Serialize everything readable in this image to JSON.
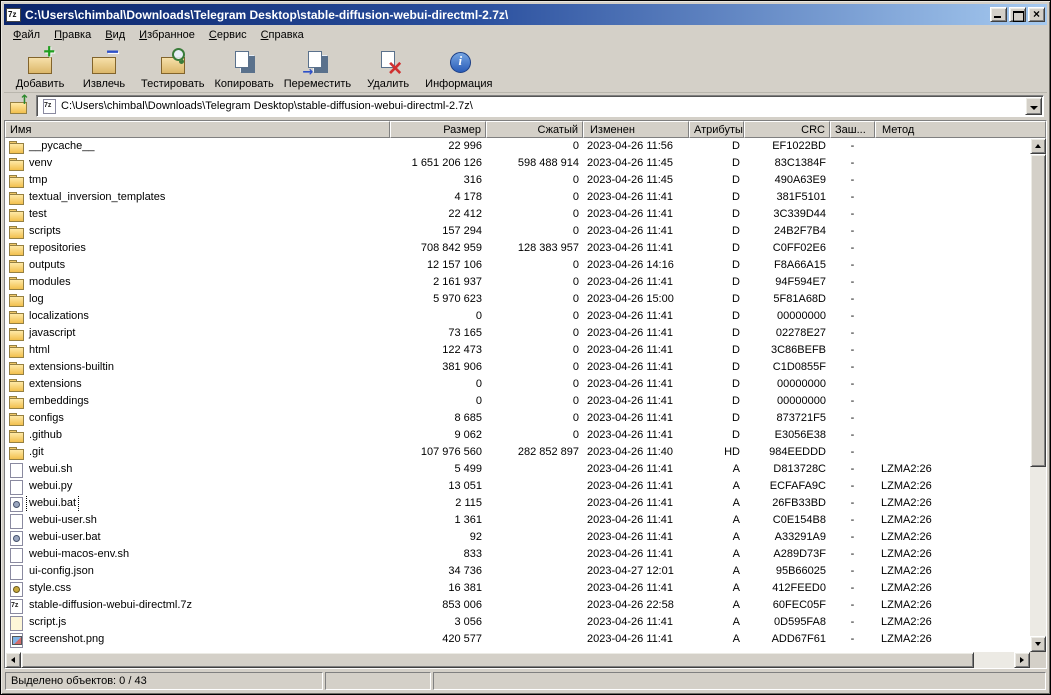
{
  "window": {
    "title": "C:\\Users\\chimbal\\Downloads\\Telegram Desktop\\stable-diffusion-webui-directml-2.7z\\",
    "app_icon": "7zip-app-icon",
    "control_icons": [
      "minimize-icon",
      "maximize-icon",
      "close-icon"
    ]
  },
  "colors": {
    "chrome": "#d4d0c8",
    "titlebar_start": "#0a246a",
    "titlebar_end": "#a6caf0",
    "list_background": "#ffffff"
  },
  "menu": {
    "items": [
      {
        "label": "Файл",
        "key": "file"
      },
      {
        "label": "Правка",
        "key": "edit"
      },
      {
        "label": "Вид",
        "key": "view"
      },
      {
        "label": "Избранное",
        "key": "favorites"
      },
      {
        "label": "Сервис",
        "key": "tools"
      },
      {
        "label": "Справка",
        "key": "help"
      }
    ]
  },
  "toolbar": {
    "buttons": [
      {
        "label": "Добавить",
        "icon": "add"
      },
      {
        "label": "Извлечь",
        "icon": "extract"
      },
      {
        "label": "Тестировать",
        "icon": "test"
      },
      {
        "label": "Копировать",
        "icon": "copy"
      },
      {
        "label": "Переместить",
        "icon": "move"
      },
      {
        "label": "Удалить",
        "icon": "delete"
      },
      {
        "label": "Информация",
        "icon": "info"
      }
    ]
  },
  "address": {
    "path": "C:\\Users\\chimbal\\Downloads\\Telegram Desktop\\stable-diffusion-webui-directml-2.7z\\",
    "icons": [
      "up-folder-icon",
      "archive-icon",
      "chevron-down-icon"
    ]
  },
  "list": {
    "columns": [
      {
        "label": "Имя",
        "key": "name"
      },
      {
        "label": "Размер",
        "key": "size"
      },
      {
        "label": "Сжатый",
        "key": "compressed"
      },
      {
        "label": "Изменен",
        "key": "modified"
      },
      {
        "label": "Атрибуты",
        "key": "attributes"
      },
      {
        "label": "CRC",
        "key": "crc"
      },
      {
        "label": "Заш...",
        "key": "encrypted"
      },
      {
        "label": "Метод",
        "key": "method"
      }
    ],
    "rows": [
      {
        "icon": "folder",
        "name": "__pycache__",
        "size": "22 996",
        "compressed": "0",
        "modified": "2023-04-26 11:56",
        "attributes": "D",
        "crc": "EF1022BD",
        "encrypted": "-",
        "method": ""
      },
      {
        "icon": "folder",
        "name": "venv",
        "size": "1 651 206 126",
        "compressed": "598 488 914",
        "modified": "2023-04-26 11:45",
        "attributes": "D",
        "crc": "83C1384F",
        "encrypted": "-",
        "method": ""
      },
      {
        "icon": "folder",
        "name": "tmp",
        "size": "316",
        "compressed": "0",
        "modified": "2023-04-26 11:45",
        "attributes": "D",
        "crc": "490A63E9",
        "encrypted": "-",
        "method": ""
      },
      {
        "icon": "folder",
        "name": "textual_inversion_templates",
        "size": "4 178",
        "compressed": "0",
        "modified": "2023-04-26 11:41",
        "attributes": "D",
        "crc": "381F5101",
        "encrypted": "-",
        "method": ""
      },
      {
        "icon": "folder",
        "name": "test",
        "size": "22 412",
        "compressed": "0",
        "modified": "2023-04-26 11:41",
        "attributes": "D",
        "crc": "3C339D44",
        "encrypted": "-",
        "method": ""
      },
      {
        "icon": "folder",
        "name": "scripts",
        "size": "157 294",
        "compressed": "0",
        "modified": "2023-04-26 11:41",
        "attributes": "D",
        "crc": "24B2F7B4",
        "encrypted": "-",
        "method": ""
      },
      {
        "icon": "folder",
        "name": "repositories",
        "size": "708 842 959",
        "compressed": "128 383 957",
        "modified": "2023-04-26 11:41",
        "attributes": "D",
        "crc": "C0FF02E6",
        "encrypted": "-",
        "method": ""
      },
      {
        "icon": "folder",
        "name": "outputs",
        "size": "12 157 106",
        "compressed": "0",
        "modified": "2023-04-26 14:16",
        "attributes": "D",
        "crc": "F8A66A15",
        "encrypted": "-",
        "method": ""
      },
      {
        "icon": "folder",
        "name": "modules",
        "size": "2 161 937",
        "compressed": "0",
        "modified": "2023-04-26 11:41",
        "attributes": "D",
        "crc": "94F594E7",
        "encrypted": "-",
        "method": ""
      },
      {
        "icon": "folder",
        "name": "log",
        "size": "5 970 623",
        "compressed": "0",
        "modified": "2023-04-26 15:00",
        "attributes": "D",
        "crc": "5F81A68D",
        "encrypted": "-",
        "method": ""
      },
      {
        "icon": "folder",
        "name": "localizations",
        "size": "0",
        "compressed": "0",
        "modified": "2023-04-26 11:41",
        "attributes": "D",
        "crc": "00000000",
        "encrypted": "-",
        "method": ""
      },
      {
        "icon": "folder",
        "name": "javascript",
        "size": "73 165",
        "compressed": "0",
        "modified": "2023-04-26 11:41",
        "attributes": "D",
        "crc": "02278E27",
        "encrypted": "-",
        "method": ""
      },
      {
        "icon": "folder",
        "name": "html",
        "size": "122 473",
        "compressed": "0",
        "modified": "2023-04-26 11:41",
        "attributes": "D",
        "crc": "3C86BEFB",
        "encrypted": "-",
        "method": ""
      },
      {
        "icon": "folder",
        "name": "extensions-builtin",
        "size": "381 906",
        "compressed": "0",
        "modified": "2023-04-26 11:41",
        "attributes": "D",
        "crc": "C1D0855F",
        "encrypted": "-",
        "method": ""
      },
      {
        "icon": "folder",
        "name": "extensions",
        "size": "0",
        "compressed": "0",
        "modified": "2023-04-26 11:41",
        "attributes": "D",
        "crc": "00000000",
        "encrypted": "-",
        "method": ""
      },
      {
        "icon": "folder",
        "name": "embeddings",
        "size": "0",
        "compressed": "0",
        "modified": "2023-04-26 11:41",
        "attributes": "D",
        "crc": "00000000",
        "encrypted": "-",
        "method": ""
      },
      {
        "icon": "folder",
        "name": "configs",
        "size": "8 685",
        "compressed": "0",
        "modified": "2023-04-26 11:41",
        "attributes": "D",
        "crc": "873721F5",
        "encrypted": "-",
        "method": ""
      },
      {
        "icon": "folder",
        "name": ".github",
        "size": "9 062",
        "compressed": "0",
        "modified": "2023-04-26 11:41",
        "attributes": "D",
        "crc": "E3056E38",
        "encrypted": "-",
        "method": ""
      },
      {
        "icon": "folder",
        "name": ".git",
        "size": "107 976 560",
        "compressed": "282 852 897",
        "modified": "2023-04-26 11:40",
        "attributes": "HD",
        "crc": "984EEDDD",
        "encrypted": "-",
        "method": ""
      },
      {
        "icon": "file",
        "name": "webui.sh",
        "size": "5 499",
        "compressed": "",
        "modified": "2023-04-26 11:41",
        "attributes": "A",
        "crc": "D813728C",
        "encrypted": "-",
        "method": "LZMA2:26"
      },
      {
        "icon": "file",
        "name": "webui.py",
        "size": "13 051",
        "compressed": "",
        "modified": "2023-04-26 11:41",
        "attributes": "A",
        "crc": "ECFAFA9C",
        "encrypted": "-",
        "method": "LZMA2:26"
      },
      {
        "icon": "bat",
        "name": "webui.bat",
        "size": "2 115",
        "compressed": "",
        "modified": "2023-04-26 11:41",
        "attributes": "A",
        "crc": "26FB33BD",
        "encrypted": "-",
        "method": "LZMA2:26",
        "focused": true
      },
      {
        "icon": "file",
        "name": "webui-user.sh",
        "size": "1 361",
        "compressed": "",
        "modified": "2023-04-26 11:41",
        "attributes": "A",
        "crc": "C0E154B8",
        "encrypted": "-",
        "method": "LZMA2:26"
      },
      {
        "icon": "bat",
        "name": "webui-user.bat",
        "size": "92",
        "compressed": "",
        "modified": "2023-04-26 11:41",
        "attributes": "A",
        "crc": "A33291A9",
        "encrypted": "-",
        "method": "LZMA2:26"
      },
      {
        "icon": "file",
        "name": "webui-macos-env.sh",
        "size": "833",
        "compressed": "",
        "modified": "2023-04-26 11:41",
        "attributes": "A",
        "crc": "A289D73F",
        "encrypted": "-",
        "method": "LZMA2:26"
      },
      {
        "icon": "file",
        "name": "ui-config.json",
        "size": "34 736",
        "compressed": "",
        "modified": "2023-04-27 12:01",
        "attributes": "A",
        "crc": "95B66025",
        "encrypted": "-",
        "method": "LZMA2:26"
      },
      {
        "icon": "css",
        "name": "style.css",
        "size": "16 381",
        "compressed": "",
        "modified": "2023-04-26 11:41",
        "attributes": "A",
        "crc": "412FEED0",
        "encrypted": "-",
        "method": "LZMA2:26"
      },
      {
        "icon": "7z",
        "name": "stable-diffusion-webui-directml.7z",
        "size": "853 006",
        "compressed": "",
        "modified": "2023-04-26 22:58",
        "attributes": "A",
        "crc": "60FEC05F",
        "encrypted": "-",
        "method": "LZMA2:26"
      },
      {
        "icon": "js",
        "name": "script.js",
        "size": "3 056",
        "compressed": "",
        "modified": "2023-04-26 11:41",
        "attributes": "A",
        "crc": "0D595FA8",
        "encrypted": "-",
        "method": "LZMA2:26"
      },
      {
        "icon": "png",
        "name": "screenshot.png",
        "size": "420 577",
        "compressed": "",
        "modified": "2023-04-26 11:41",
        "attributes": "A",
        "crc": "ADD67F61",
        "encrypted": "-",
        "method": "LZMA2:26"
      }
    ]
  },
  "statusbar": {
    "selected": "Выделено объектов: 0 / 43"
  }
}
